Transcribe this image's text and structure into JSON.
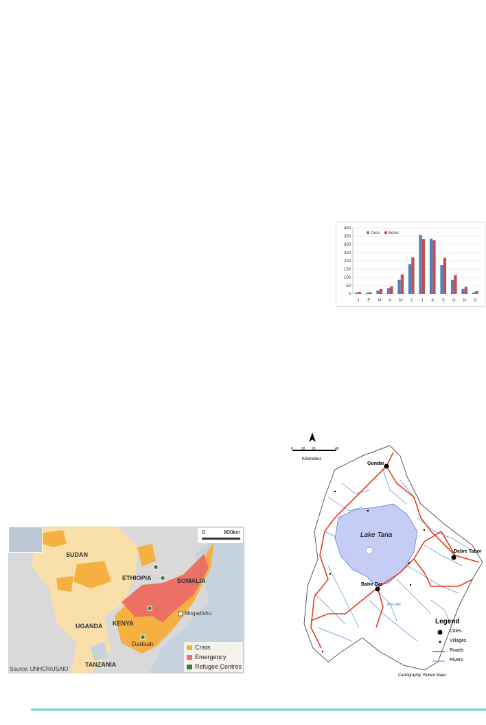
{
  "chart_data": {
    "type": "bar",
    "categories": [
      "J",
      "F",
      "M",
      "A",
      "M",
      "J",
      "J",
      "A",
      "S",
      "O",
      "N",
      "D"
    ],
    "series": [
      {
        "name": "Tana",
        "color": "#4f81bd",
        "values": [
          8,
          5,
          20,
          35,
          85,
          180,
          358,
          335,
          175,
          85,
          30,
          8
        ]
      },
      {
        "name": "Beles",
        "color": "#c0504d",
        "values": [
          12,
          10,
          30,
          45,
          118,
          222,
          333,
          325,
          218,
          113,
          43,
          17
        ]
      }
    ],
    "yticks": [
      "0",
      "50",
      "100",
      "150",
      "200",
      "250",
      "300",
      "350",
      "400"
    ],
    "ylim": [
      0,
      400
    ],
    "grid": true,
    "legend": "top-left"
  },
  "africa_map": {
    "labels": {
      "sudan": "SUDAN",
      "ethiopia": "ETHIOPIA",
      "somalia": "SOMALIA",
      "uganda": "UGANDA",
      "kenya": "KENYA",
      "tanzania": "TANZANIA",
      "mogadishu": "Mogadishu",
      "dadaab": "Dadaab"
    },
    "scale_start": "0",
    "scale_end": "800km",
    "source": "Source: UNHCR/USAID",
    "legend": [
      {
        "label": "Crisis",
        "color": "#f5b041"
      },
      {
        "label": "Emergency",
        "color": "#ec7063"
      },
      {
        "label": "Refugee Centres",
        "color": "#3a7a32"
      }
    ],
    "colors": {
      "sea": "#c6d3de",
      "land": "#d9d9d9",
      "crisis": "#f5b041",
      "emergency": "#ec7063",
      "pale": "#f9dfaa"
    }
  },
  "tana_map": {
    "scale_ticks": [
      "0",
      "10",
      "20",
      "",
      "40"
    ],
    "scale_unit": "Kilometers",
    "lake": "Lake Tana",
    "cities": {
      "gondar": "Gondar",
      "debre_tabor": "Debre Tabor",
      "bahir_dar": "Bahir Dar"
    },
    "blue_nile": "Blue Nile",
    "legend_title": "Legend",
    "legend_items": {
      "cities": "Cities",
      "villages": "Villages",
      "roads": "Roads",
      "rivers": "Rivers"
    },
    "credit": "Cartography: Ruben Maes",
    "colors": {
      "lake": "#c5cdf5",
      "roads": "#e53b1e",
      "rivers": "#4a8fd8"
    }
  },
  "footer": {
    "rule_color": "#6fd7d8"
  }
}
